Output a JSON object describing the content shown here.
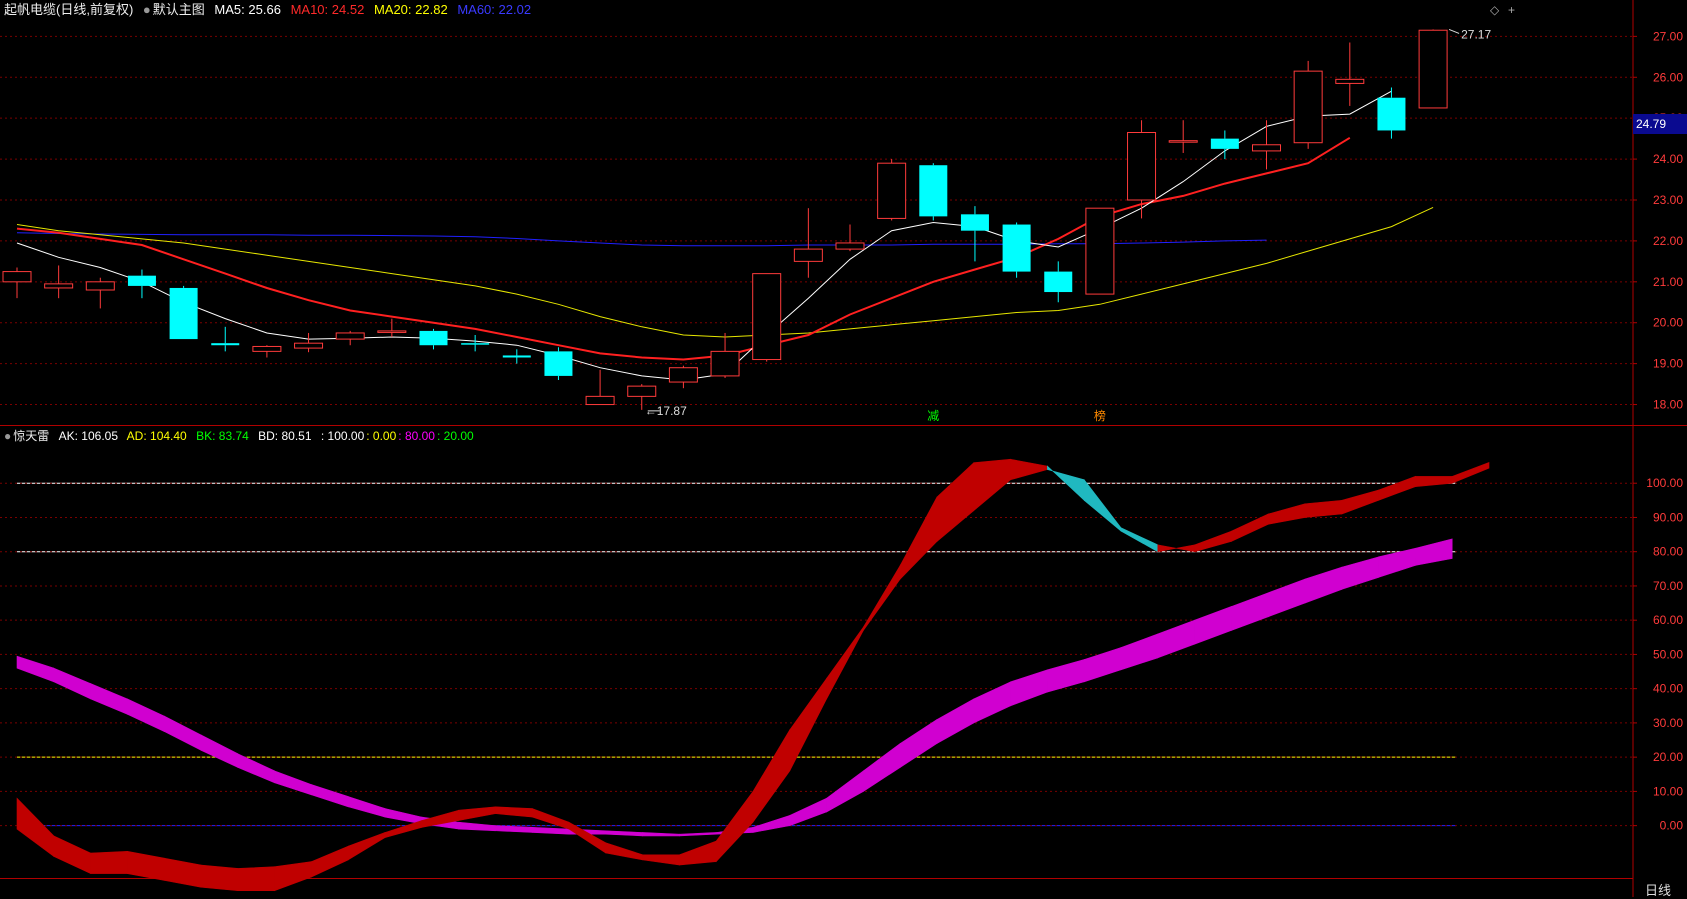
{
  "header": {
    "stock_name": "起帆电缆",
    "mode": "(日线,前复权)",
    "template": "默认主图",
    "ma": [
      {
        "label": "MA5:",
        "value": "25.66",
        "color": "#ffffff"
      },
      {
        "label": "MA10:",
        "value": "24.52",
        "color": "#ff2a2a"
      },
      {
        "label": "MA20:",
        "value": "22.82",
        "color": "#ffff00"
      },
      {
        "label": "MA60:",
        "value": "22.02",
        "color": "#2a2aff"
      }
    ]
  },
  "indicator_header": {
    "name": "惊天雷",
    "items": [
      {
        "label": "AK:",
        "value": "106.05",
        "color": "#ffffff"
      },
      {
        "label": "AD:",
        "value": "104.40",
        "color": "#ffff00"
      },
      {
        "label": "BK:",
        "value": "83.74",
        "color": "#00ff00"
      },
      {
        "label": "BD:",
        "value": "80.51",
        "color": "#ffffff"
      }
    ],
    "levels": [
      {
        "text": ": 100.00",
        "color": "#ffffff"
      },
      {
        "text": ": 0.00",
        "color": "#ffff00"
      },
      {
        "text": ": 80.00",
        "color": "#ff00ff"
      },
      {
        "text": ": 20.00",
        "color": "#00ff00"
      }
    ]
  },
  "price_box": "24.79",
  "corner_icons": [
    "◇",
    "+"
  ],
  "period_label": "日线",
  "colors": {
    "up": "#ff3b3b",
    "down": "#00ffff",
    "ma5": "#ffffff",
    "ma10": "#ff2020",
    "ma20": "#e6e600",
    "ma60": "#2020ff",
    "grid": "#7a0000"
  },
  "chart_data": [
    {
      "type": "candlestick",
      "ylim": [
        17.5,
        27.4
      ],
      "yticks": [
        "27.00",
        "26.00",
        "25.00",
        "24.00",
        "23.00",
        "22.00",
        "21.00",
        "20.00",
        "19.00",
        "18.00"
      ],
      "tick_values": [
        27,
        26,
        25,
        24,
        23,
        22,
        21,
        20,
        19,
        18
      ],
      "annotations": {
        "high": "27.17",
        "low": "17.87"
      },
      "markers": [
        {
          "index": 22,
          "text": "减",
          "color": "#00ff00"
        },
        {
          "index": 26,
          "text": "榜",
          "color": "#ff8a00"
        }
      ],
      "candles": [
        {
          "o": 21.0,
          "c": 21.25,
          "h": 21.35,
          "l": 20.6
        },
        {
          "o": 20.85,
          "c": 20.95,
          "h": 21.4,
          "l": 20.6
        },
        {
          "o": 20.8,
          "c": 21.0,
          "h": 21.1,
          "l": 20.35
        },
        {
          "o": 21.15,
          "c": 20.9,
          "h": 21.3,
          "l": 20.6
        },
        {
          "o": 20.85,
          "c": 19.6,
          "h": 20.9,
          "l": 19.6
        },
        {
          "o": 19.5,
          "c": 19.45,
          "h": 19.9,
          "l": 19.3
        },
        {
          "o": 19.3,
          "c": 19.42,
          "h": 19.45,
          "l": 19.15
        },
        {
          "o": 19.38,
          "c": 19.5,
          "h": 19.75,
          "l": 19.28
        },
        {
          "o": 19.6,
          "c": 19.75,
          "h": 19.8,
          "l": 19.45
        },
        {
          "o": 19.8,
          "c": 19.8,
          "h": 20.1,
          "l": 19.65
        },
        {
          "o": 19.8,
          "c": 19.45,
          "h": 19.85,
          "l": 19.35
        },
        {
          "o": 19.5,
          "c": 19.48,
          "h": 19.7,
          "l": 19.3
        },
        {
          "o": 19.2,
          "c": 19.15,
          "h": 19.35,
          "l": 19.0
        },
        {
          "o": 19.3,
          "c": 18.7,
          "h": 19.4,
          "l": 18.6
        },
        {
          "o": 18.0,
          "c": 18.2,
          "h": 18.85,
          "l": 18.0
        },
        {
          "o": 18.2,
          "c": 18.45,
          "h": 18.5,
          "l": 17.87
        },
        {
          "o": 18.55,
          "c": 18.9,
          "h": 18.95,
          "l": 18.4
        },
        {
          "o": 18.7,
          "c": 19.3,
          "h": 19.75,
          "l": 18.65
        },
        {
          "o": 19.1,
          "c": 21.2,
          "h": 21.2,
          "l": 19.05
        },
        {
          "o": 21.5,
          "c": 21.8,
          "h": 22.8,
          "l": 21.1
        },
        {
          "o": 21.8,
          "c": 21.95,
          "h": 22.4,
          "l": 21.75
        },
        {
          "o": 22.55,
          "c": 23.9,
          "h": 24.0,
          "l": 22.5
        },
        {
          "o": 23.85,
          "c": 22.6,
          "h": 23.9,
          "l": 22.5
        },
        {
          "o": 22.65,
          "c": 22.25,
          "h": 22.85,
          "l": 21.5
        },
        {
          "o": 22.4,
          "c": 21.25,
          "h": 22.45,
          "l": 21.1
        },
        {
          "o": 21.25,
          "c": 20.75,
          "h": 21.5,
          "l": 20.5
        },
        {
          "o": 20.7,
          "c": 22.8,
          "h": 22.8,
          "l": 20.7
        },
        {
          "o": 23.0,
          "c": 24.65,
          "h": 24.95,
          "l": 22.55
        },
        {
          "o": 24.45,
          "c": 24.45,
          "h": 24.95,
          "l": 24.15
        },
        {
          "o": 24.5,
          "c": 24.25,
          "h": 24.7,
          "l": 24.0
        },
        {
          "o": 24.2,
          "c": 24.35,
          "h": 24.95,
          "l": 23.75
        },
        {
          "o": 24.4,
          "c": 26.15,
          "h": 26.4,
          "l": 24.25
        },
        {
          "o": 25.85,
          "c": 25.95,
          "h": 26.85,
          "l": 25.3
        },
        {
          "o": 25.5,
          "c": 24.7,
          "h": 25.75,
          "l": 24.5
        },
        {
          "o": 25.25,
          "c": 27.15,
          "h": 27.17,
          "l": 25.25
        }
      ],
      "ma5": [
        21.95,
        21.6,
        21.35,
        21.0,
        20.5,
        20.1,
        19.75,
        19.6,
        19.62,
        19.65,
        19.62,
        19.55,
        19.45,
        19.2,
        18.9,
        18.7,
        18.6,
        18.75,
        19.7,
        20.6,
        21.55,
        22.25,
        22.45,
        22.35,
        22.0,
        21.85,
        22.3,
        22.8,
        23.45,
        24.2,
        24.8,
        25.05,
        25.1,
        25.66
      ],
      "ma10": [
        22.3,
        22.2,
        22.05,
        21.9,
        21.55,
        21.2,
        20.85,
        20.55,
        20.3,
        20.15,
        20.0,
        19.85,
        19.65,
        19.45,
        19.25,
        19.15,
        19.1,
        19.2,
        19.45,
        19.7,
        20.2,
        20.6,
        21.0,
        21.3,
        21.6,
        22.05,
        22.6,
        22.9,
        23.1,
        23.4,
        23.65,
        23.9,
        24.52
      ],
      "ma20": [
        22.4,
        22.25,
        22.15,
        22.05,
        21.95,
        21.8,
        21.65,
        21.5,
        21.35,
        21.2,
        21.05,
        20.9,
        20.7,
        20.45,
        20.15,
        19.9,
        19.7,
        19.65,
        19.7,
        19.75,
        19.85,
        19.95,
        20.05,
        20.15,
        20.25,
        20.3,
        20.45,
        20.7,
        20.95,
        21.2,
        21.45,
        21.75,
        22.05,
        22.35,
        22.82
      ],
      "ma60": [
        22.2,
        22.18,
        22.17,
        22.16,
        22.15,
        22.15,
        22.15,
        22.14,
        22.14,
        22.13,
        22.12,
        22.1,
        22.06,
        22.0,
        21.95,
        21.9,
        21.88,
        21.88,
        21.88,
        21.9,
        21.9,
        21.9,
        21.92,
        21.92,
        21.92,
        21.93,
        21.93,
        21.95,
        21.97,
        22.0,
        22.02
      ]
    },
    {
      "type": "area",
      "ylim": [
        -15,
        117
      ],
      "yticks": [
        "100.00",
        "90.00",
        "80.00",
        "70.00",
        "60.00",
        "50.00",
        "40.00",
        "30.00",
        "20.00",
        "10.00",
        "0.00"
      ],
      "tick_values": [
        100,
        90,
        80,
        70,
        60,
        50,
        40,
        30,
        20,
        10,
        0
      ],
      "reference_lines": [
        {
          "value": 100,
          "color": "#ffffff"
        },
        {
          "value": 80,
          "color": "#ffffff"
        },
        {
          "value": 20,
          "color": "#ffff00"
        },
        {
          "value": 0,
          "color": "#2020ff"
        }
      ],
      "AK": [
        8,
        -3,
        -8,
        -7.5,
        -9.5,
        -11.5,
        -12.5,
        -12,
        -10.5,
        -6,
        -2,
        1.5,
        4.5,
        5.5,
        5,
        1,
        -5,
        -8.5,
        -8.5,
        -4.5,
        10,
        28,
        43,
        58,
        76,
        96,
        106,
        107,
        105,
        95,
        86,
        80,
        82,
        86,
        91,
        94,
        95,
        98,
        102,
        102,
        106.05
      ],
      "AD": [
        -1,
        -9,
        -14,
        -14,
        -16,
        -18,
        -19,
        -19,
        -15,
        -10,
        -3.5,
        -0.5,
        1.5,
        3.5,
        2.5,
        -1,
        -8,
        -10,
        -11.5,
        -10.5,
        1,
        16,
        37,
        57,
        72,
        83,
        92,
        101,
        104,
        101,
        87,
        82,
        80,
        83,
        88,
        90,
        91,
        95,
        99,
        100,
        104.4
      ],
      "BK": [
        49.5,
        46,
        41.5,
        37,
        32,
        26.5,
        21,
        16,
        12,
        8.5,
        5,
        2.5,
        1,
        0,
        -0.5,
        -1,
        -1.5,
        -2,
        -2.5,
        -2,
        -0.5,
        3,
        8,
        16,
        24,
        31,
        37,
        42,
        45.5,
        48.5,
        52,
        56,
        60,
        64,
        68,
        72,
        75.5,
        78.5,
        81,
        83.74
      ],
      "BD": [
        46,
        42,
        37,
        32.5,
        27.5,
        22,
        17,
        12.5,
        9,
        5.5,
        2.5,
        0.5,
        -1,
        -1.5,
        -2,
        -2.5,
        -2.5,
        -3,
        -3,
        -2.5,
        -2,
        0,
        4,
        10,
        17,
        24,
        30,
        35,
        39,
        42,
        45.5,
        49,
        53,
        57,
        61,
        65,
        69,
        72.5,
        76,
        78,
        80.51
      ]
    }
  ]
}
